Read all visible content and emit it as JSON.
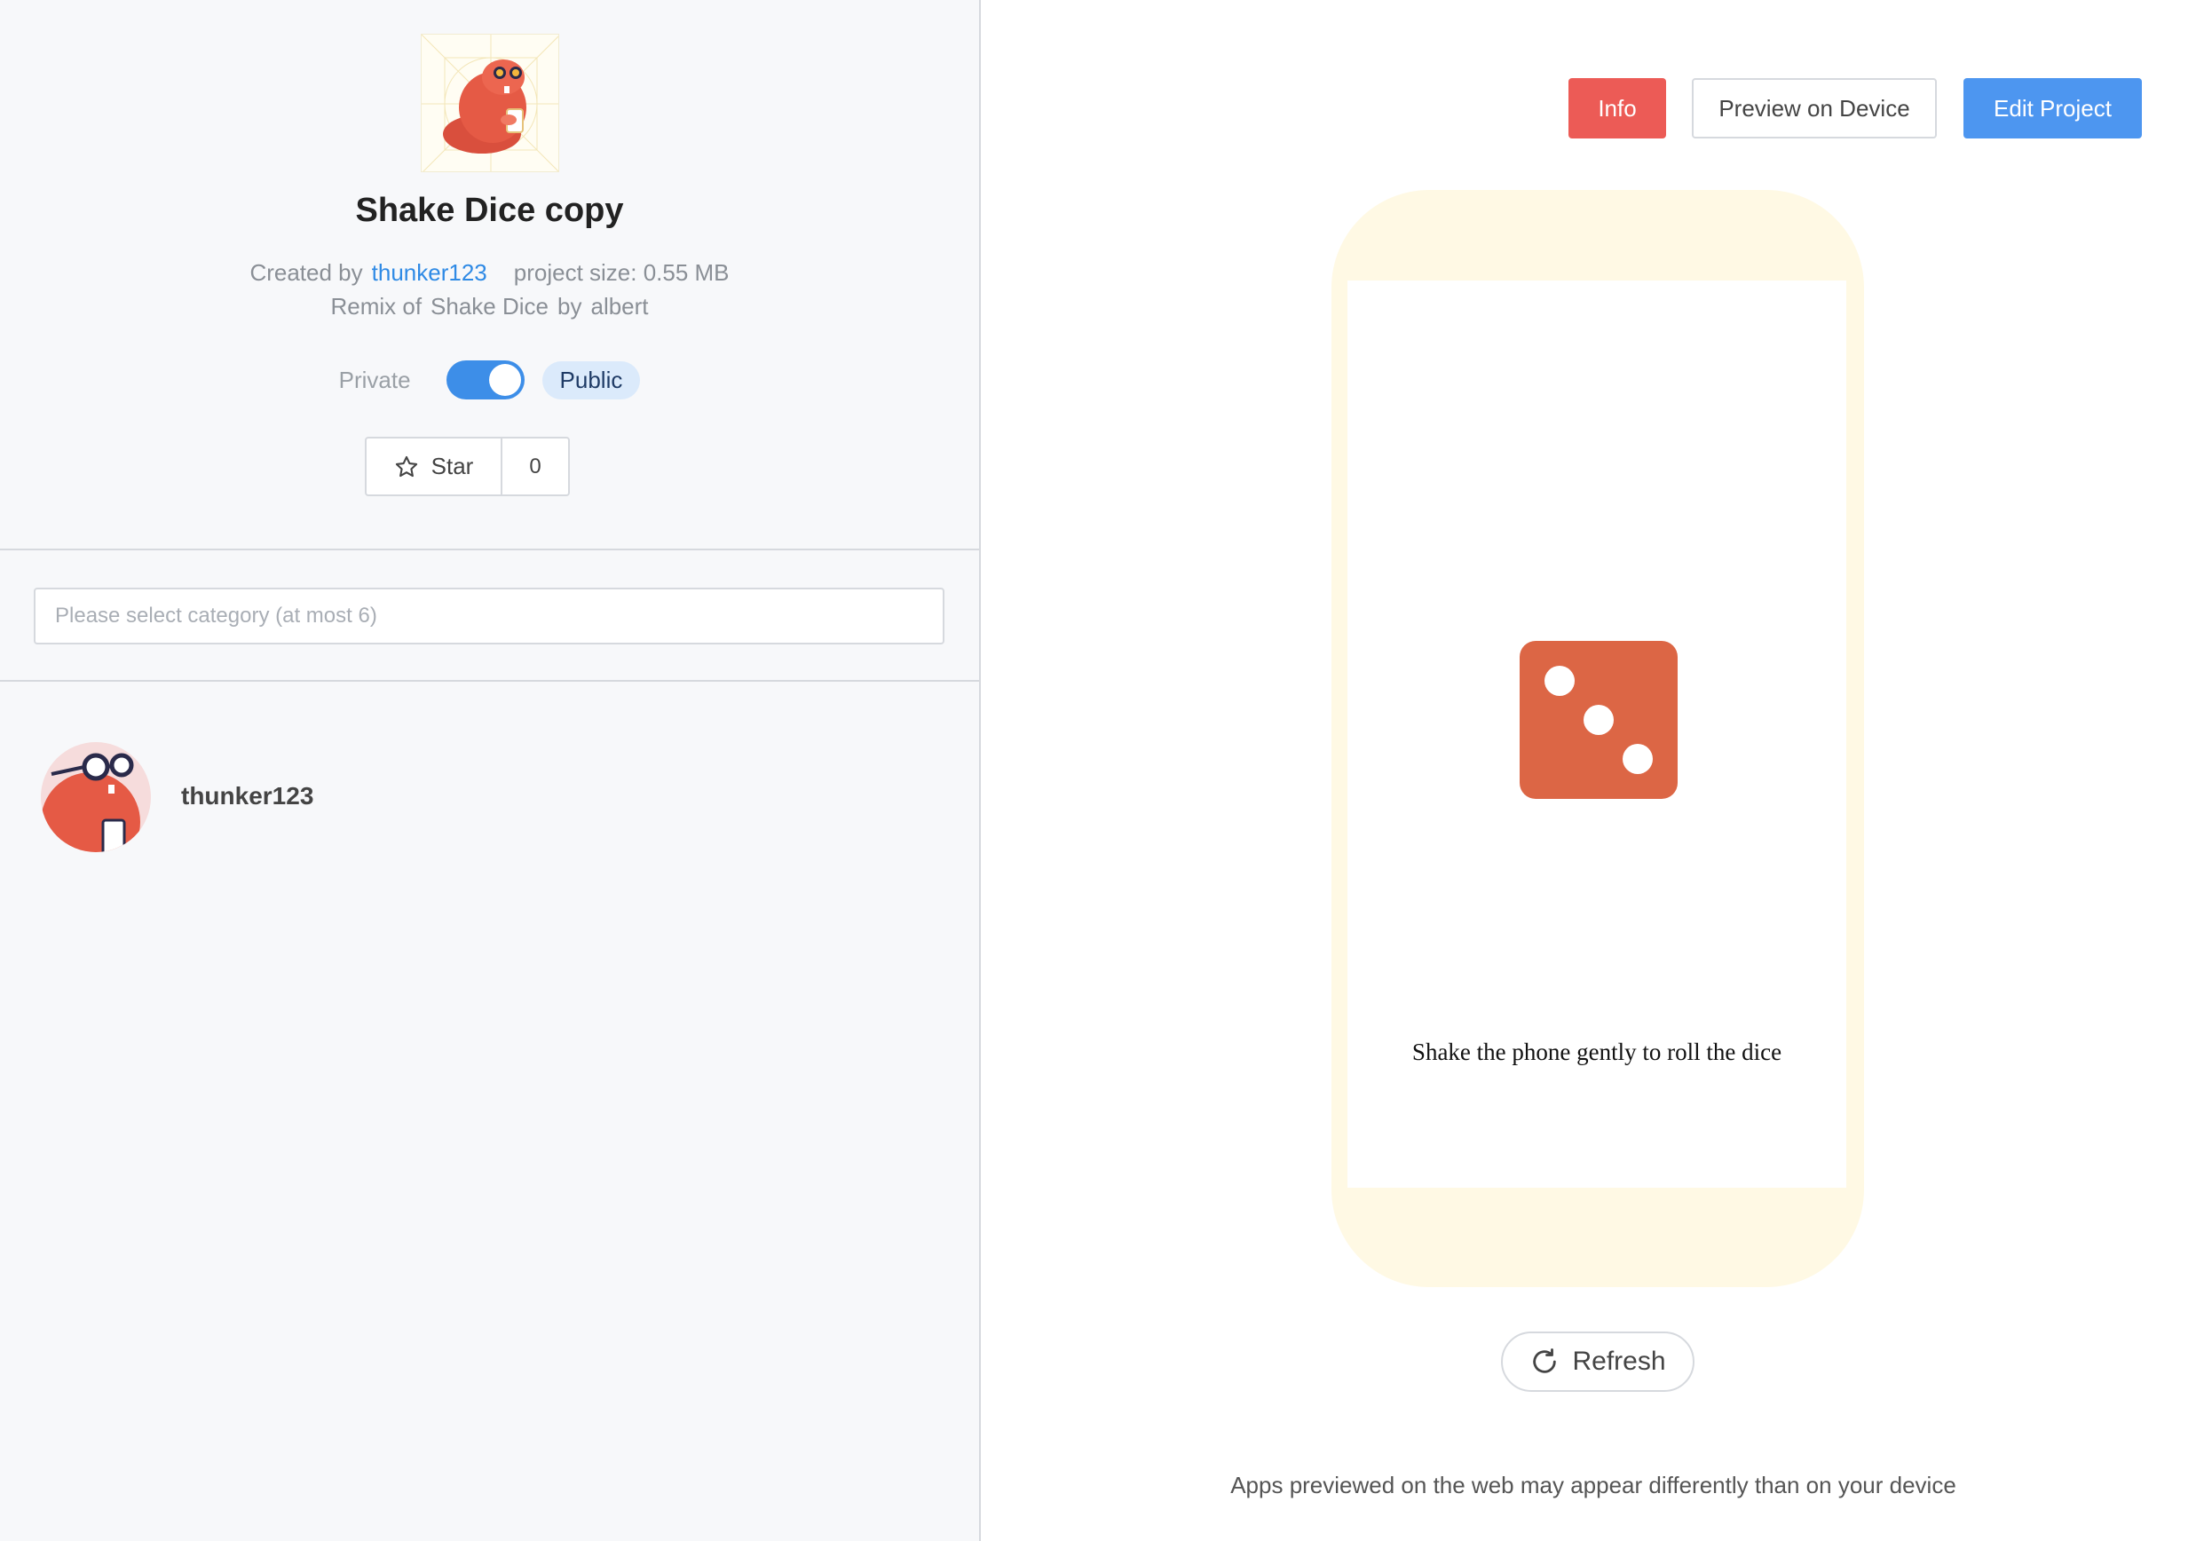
{
  "project": {
    "title": "Shake Dice copy",
    "created_by_label": "Created by",
    "creator": "thunker123",
    "size_text": "project size: 0.55 MB",
    "remix_of_label": "Remix of",
    "remix_source": "Shake Dice",
    "remix_by_label": "by",
    "remix_author": "albert"
  },
  "privacy": {
    "private_label": "Private",
    "public_label": "Public",
    "is_public": true
  },
  "star": {
    "label": "Star",
    "count": "0"
  },
  "category": {
    "placeholder": "Please select category (at most 6)"
  },
  "owner": {
    "name": "thunker123"
  },
  "toolbar": {
    "info_label": "Info",
    "preview_label": "Preview on Device",
    "edit_label": "Edit Project"
  },
  "preview": {
    "screen_text": "Shake the phone gently to roll the dice",
    "die_value": 3,
    "refresh_label": "Refresh",
    "footer_note": "Apps previewed on the web may appear differently than on your device"
  },
  "colors": {
    "accent_blue": "#4d96f0",
    "info_red": "#ec5b56",
    "die_orange": "#dc6645",
    "phone_frame": "#fff9e4",
    "link_blue": "#2f8ae5"
  },
  "icons": {
    "star": "star-outline-icon",
    "refresh": "refresh-icon",
    "project_thumb": "beaver-mascot-image",
    "avatar": "beaver-avatar-image"
  }
}
